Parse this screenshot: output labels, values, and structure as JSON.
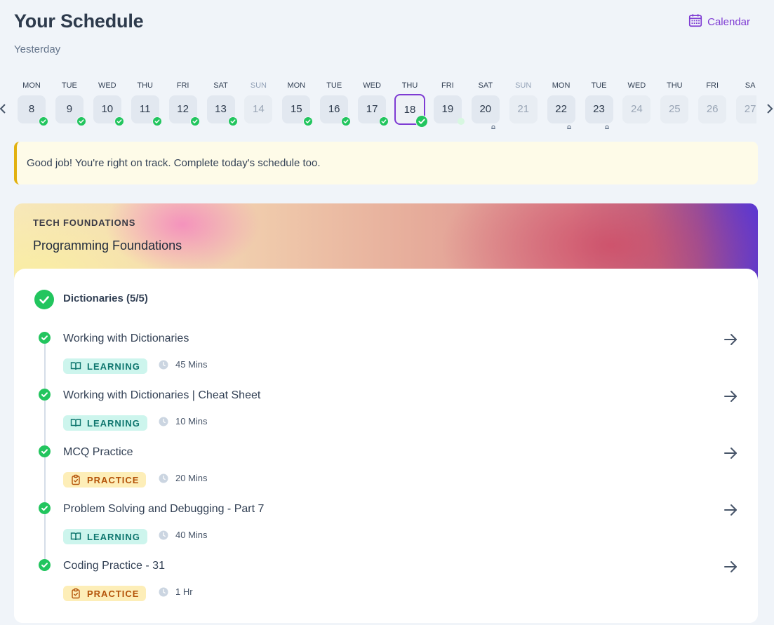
{
  "header": {
    "title": "Your Schedule",
    "subtitle": "Yesterday",
    "calendar_label": "Calendar"
  },
  "date_strip": {
    "days": [
      {
        "name": "MON",
        "date": "8",
        "status": "done"
      },
      {
        "name": "TUE",
        "date": "9",
        "status": "done"
      },
      {
        "name": "WED",
        "date": "10",
        "status": "done"
      },
      {
        "name": "THU",
        "date": "11",
        "status": "done"
      },
      {
        "name": "FRI",
        "date": "12",
        "status": "done"
      },
      {
        "name": "SAT",
        "date": "13",
        "status": "done"
      },
      {
        "name": "SUN",
        "date": "14",
        "status": "off"
      },
      {
        "name": "MON",
        "date": "15",
        "status": "done"
      },
      {
        "name": "TUE",
        "date": "16",
        "status": "done"
      },
      {
        "name": "WED",
        "date": "17",
        "status": "done"
      },
      {
        "name": "THU",
        "date": "18",
        "status": "selected"
      },
      {
        "name": "FRI",
        "date": "19",
        "status": "current"
      },
      {
        "name": "SAT",
        "date": "20",
        "status": "locked"
      },
      {
        "name": "SUN",
        "date": "21",
        "status": "off"
      },
      {
        "name": "MON",
        "date": "22",
        "status": "locked"
      },
      {
        "name": "TUE",
        "date": "23",
        "status": "locked"
      },
      {
        "name": "WED",
        "date": "24",
        "status": "future"
      },
      {
        "name": "THU",
        "date": "25",
        "status": "future"
      },
      {
        "name": "FRI",
        "date": "26",
        "status": "future"
      },
      {
        "name": "SA",
        "date": "27",
        "status": "future"
      }
    ]
  },
  "banner": {
    "text": "Good job! You're right on track. Complete today's schedule too."
  },
  "course": {
    "tag": "TECH FOUNDATIONS",
    "title": "Programming Foundations",
    "module": {
      "title": "Dictionaries (5/5)"
    },
    "items": [
      {
        "name": "Working with Dictionaries",
        "type": "LEARNING",
        "kind": "learning",
        "duration": "45 Mins"
      },
      {
        "name": "Working with Dictionaries | Cheat Sheet",
        "type": "LEARNING",
        "kind": "learning",
        "duration": "10 Mins"
      },
      {
        "name": "MCQ Practice",
        "type": "PRACTICE",
        "kind": "practice",
        "duration": "20 Mins"
      },
      {
        "name": "Problem Solving and Debugging - Part 7",
        "type": "LEARNING",
        "kind": "learning",
        "duration": "40 Mins"
      },
      {
        "name": "Coding Practice - 31",
        "type": "PRACTICE",
        "kind": "practice",
        "duration": "1 Hr"
      }
    ]
  },
  "colors": {
    "accent": "#7e3bd3",
    "success": "#22c55e",
    "warning_border": "#e2b10f"
  }
}
